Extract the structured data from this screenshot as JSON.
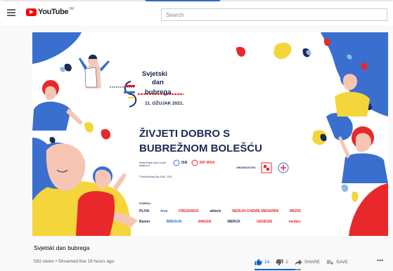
{
  "app": {
    "logo_text": "YouTube",
    "logo_country": "HR"
  },
  "search": {
    "placeholder": "Search"
  },
  "video": {
    "title": "Svjetski dan bubrega",
    "meta": "592 views • Streamed live 19 hours ago",
    "likes": "14",
    "dislikes": "2",
    "share_label": "SHARE",
    "save_label": "SAVE",
    "like_ratio": 0.875
  },
  "thumbnail": {
    "event_name_1": "Svjetski",
    "event_name_2": "dan",
    "event_name_3": "bubrega",
    "date": "11. OŽUJAK 2021.",
    "headline_1": "ŽIVJETI DOBRO S",
    "headline_2": "BUBREŽNOM BOLEŠĆU",
    "wkd_text": "World Kidney Day is a joint initiative of",
    "isn": "ISN",
    "ikf": "IKF-WKA",
    "organizers": "ORGANIZATORI:",
    "copyright": "© World Kidney Day 2006 - 2021",
    "supported_by": "PODRŽALI:",
    "sponsors_row1": [
      "PLIVA",
      "teva",
      "FRESENIUS",
      "abbvie",
      "BERLIN-CHEMIE MENARINI",
      "MEDIS"
    ],
    "sponsors_row2": [
      "Baxter",
      "BBRAUN",
      "AMGEN",
      "MERCK",
      "GENESIS",
      "medtec"
    ]
  },
  "colors": {
    "accent_blue": "#065fd4",
    "youtube_red": "#ff0000",
    "navy": "#1a2b55",
    "thumb_red": "#e8282b",
    "thumb_yellow": "#f4d63a",
    "thumb_blue": "#3a6fd0"
  }
}
